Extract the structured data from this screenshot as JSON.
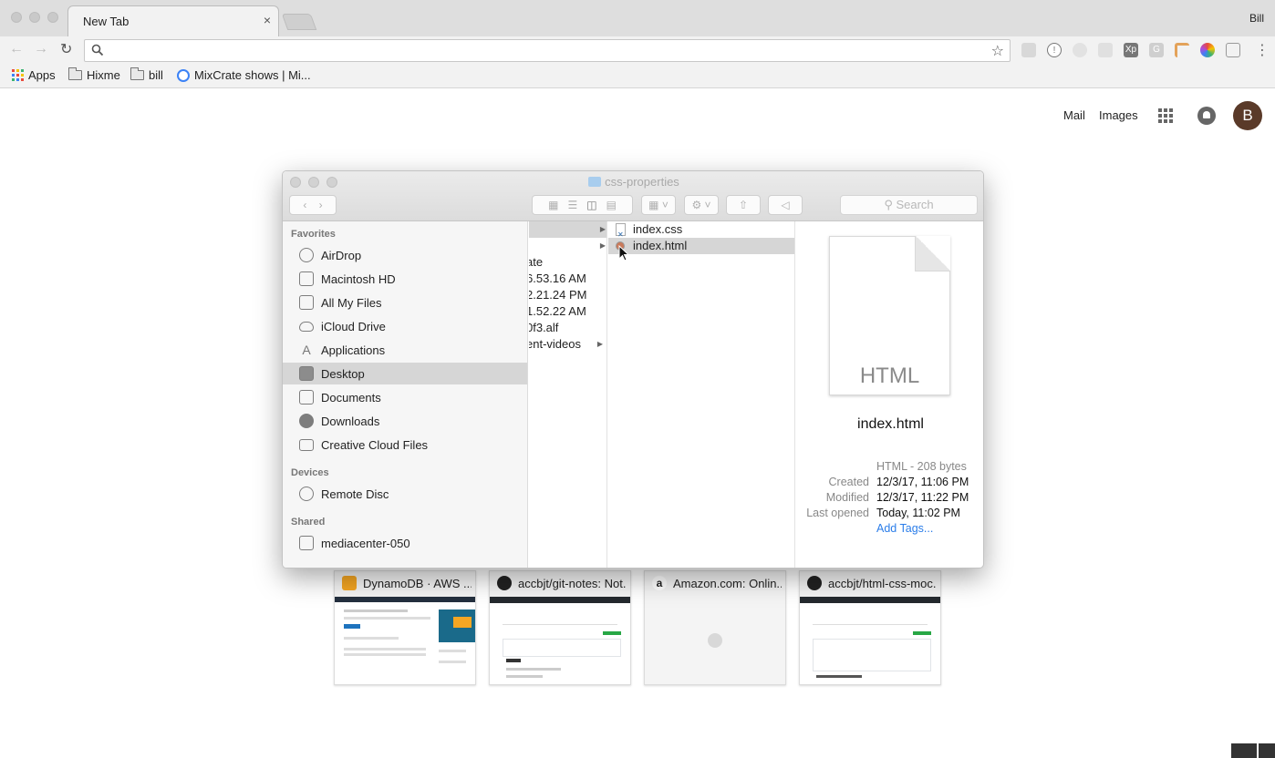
{
  "browser": {
    "tab_title": "New Tab",
    "tab_close": "×",
    "user_name": "Bill",
    "omnibox_placeholder": "",
    "extensions": [
      "Xp",
      "G"
    ],
    "bookmarks": [
      {
        "label": "Apps",
        "icon": "apps-grid-icon"
      },
      {
        "label": "Hixme",
        "icon": "folder-icon"
      },
      {
        "label": "bill",
        "icon": "folder-icon"
      },
      {
        "label": "MixCrate shows | Mi...",
        "icon": "mixcrate-icon"
      }
    ]
  },
  "google": {
    "mail": "Mail",
    "images": "Images",
    "avatar_letter": "B"
  },
  "thumbnails": [
    {
      "title": "DynamoDB · AWS ...",
      "icon": "aws-icon",
      "color": "#f5a623"
    },
    {
      "title": "accbjt/git-notes: Not...",
      "icon": "github-icon",
      "color": "#222222"
    },
    {
      "title": "Amazon.com: Onlin...",
      "icon": "amazon-icon",
      "color": "#222222"
    },
    {
      "title": "accbjt/html-css-moc...",
      "icon": "github-icon",
      "color": "#222222"
    }
  ],
  "finder": {
    "title": "css-properties",
    "search_placeholder": "Search",
    "sidebar": {
      "favorites_heading": "Favorites",
      "favorites": [
        "AirDrop",
        "Macintosh HD",
        "All My Files",
        "iCloud Drive",
        "Applications",
        "Desktop",
        "Documents",
        "Downloads",
        "Creative Cloud Files"
      ],
      "selected": "Desktop",
      "devices_heading": "Devices",
      "devices": [
        "Remote Disc"
      ],
      "shared_heading": "Shared",
      "shared": [
        "mediacenter-050"
      ]
    },
    "column1": [
      "",
      "",
      "ate",
      "6.53.16 AM",
      "2.21.24 PM",
      "1.52.22 AM",
      "0f3.alf",
      "ent-videos"
    ],
    "column2": [
      "index.css",
      "index.html"
    ],
    "selected_file": "index.html",
    "preview": {
      "doc_label": "HTML",
      "name": "index.html",
      "kind_size": "HTML - 208 bytes",
      "created_label": "Created",
      "created": "12/3/17, 11:06 PM",
      "modified_label": "Modified",
      "modified": "12/3/17, 11:22 PM",
      "opened_label": "Last opened",
      "opened": "Today, 11:02 PM",
      "add_tags": "Add Tags..."
    }
  }
}
